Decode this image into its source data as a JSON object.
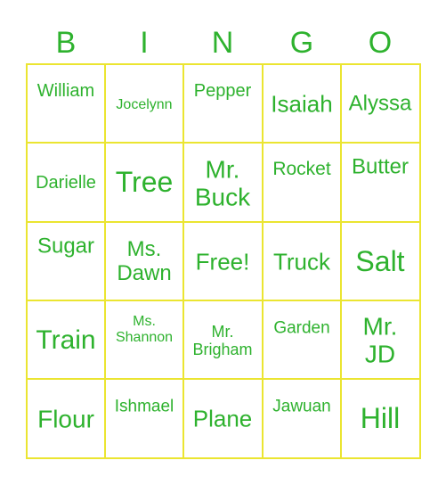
{
  "header": [
    "B",
    "I",
    "N",
    "G",
    "O"
  ],
  "colors": {
    "text": "#2eb22e",
    "grid": "#ebe531"
  },
  "cells": [
    [
      "William",
      "Jocelynn",
      "Pepper",
      "Isaiah",
      "Alyssa"
    ],
    [
      "Darielle",
      "Tree",
      "Mr.\nBuck",
      "Rocket",
      "Butter"
    ],
    [
      "Sugar",
      "Ms.\nDawn",
      "Free!",
      "Truck",
      "Salt"
    ],
    [
      "Train",
      "Ms.\nShannon",
      "Mr.\nBrigham",
      "Garden",
      "Mr.\nJD"
    ],
    [
      "Flour",
      "Ishmael",
      "Plane",
      "Jawuan",
      "Hill"
    ]
  ]
}
